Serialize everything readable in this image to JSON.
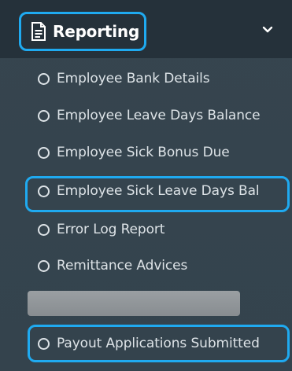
{
  "menu": {
    "header": {
      "label": "Reporting",
      "icon": "document-icon",
      "chevron_icon": "chevron-down-icon"
    },
    "items": [
      {
        "label": "Employee Bank Details"
      },
      {
        "label": "Employee Leave Days Balance"
      },
      {
        "label": "Employee Sick Bonus Due"
      },
      {
        "label": "Employee Sick Leave Days Bal",
        "highlighted": true
      },
      {
        "label": "Error Log Report"
      },
      {
        "label": "Remittance Advices"
      },
      {
        "label": "Payout Applications Submitted",
        "highlighted": true
      }
    ],
    "colors": {
      "header_background": "#25313a",
      "menu_background": "#36454f",
      "highlight": "#1faaf0",
      "item_text": "#dde3e7",
      "header_text": "#ffffff"
    }
  }
}
